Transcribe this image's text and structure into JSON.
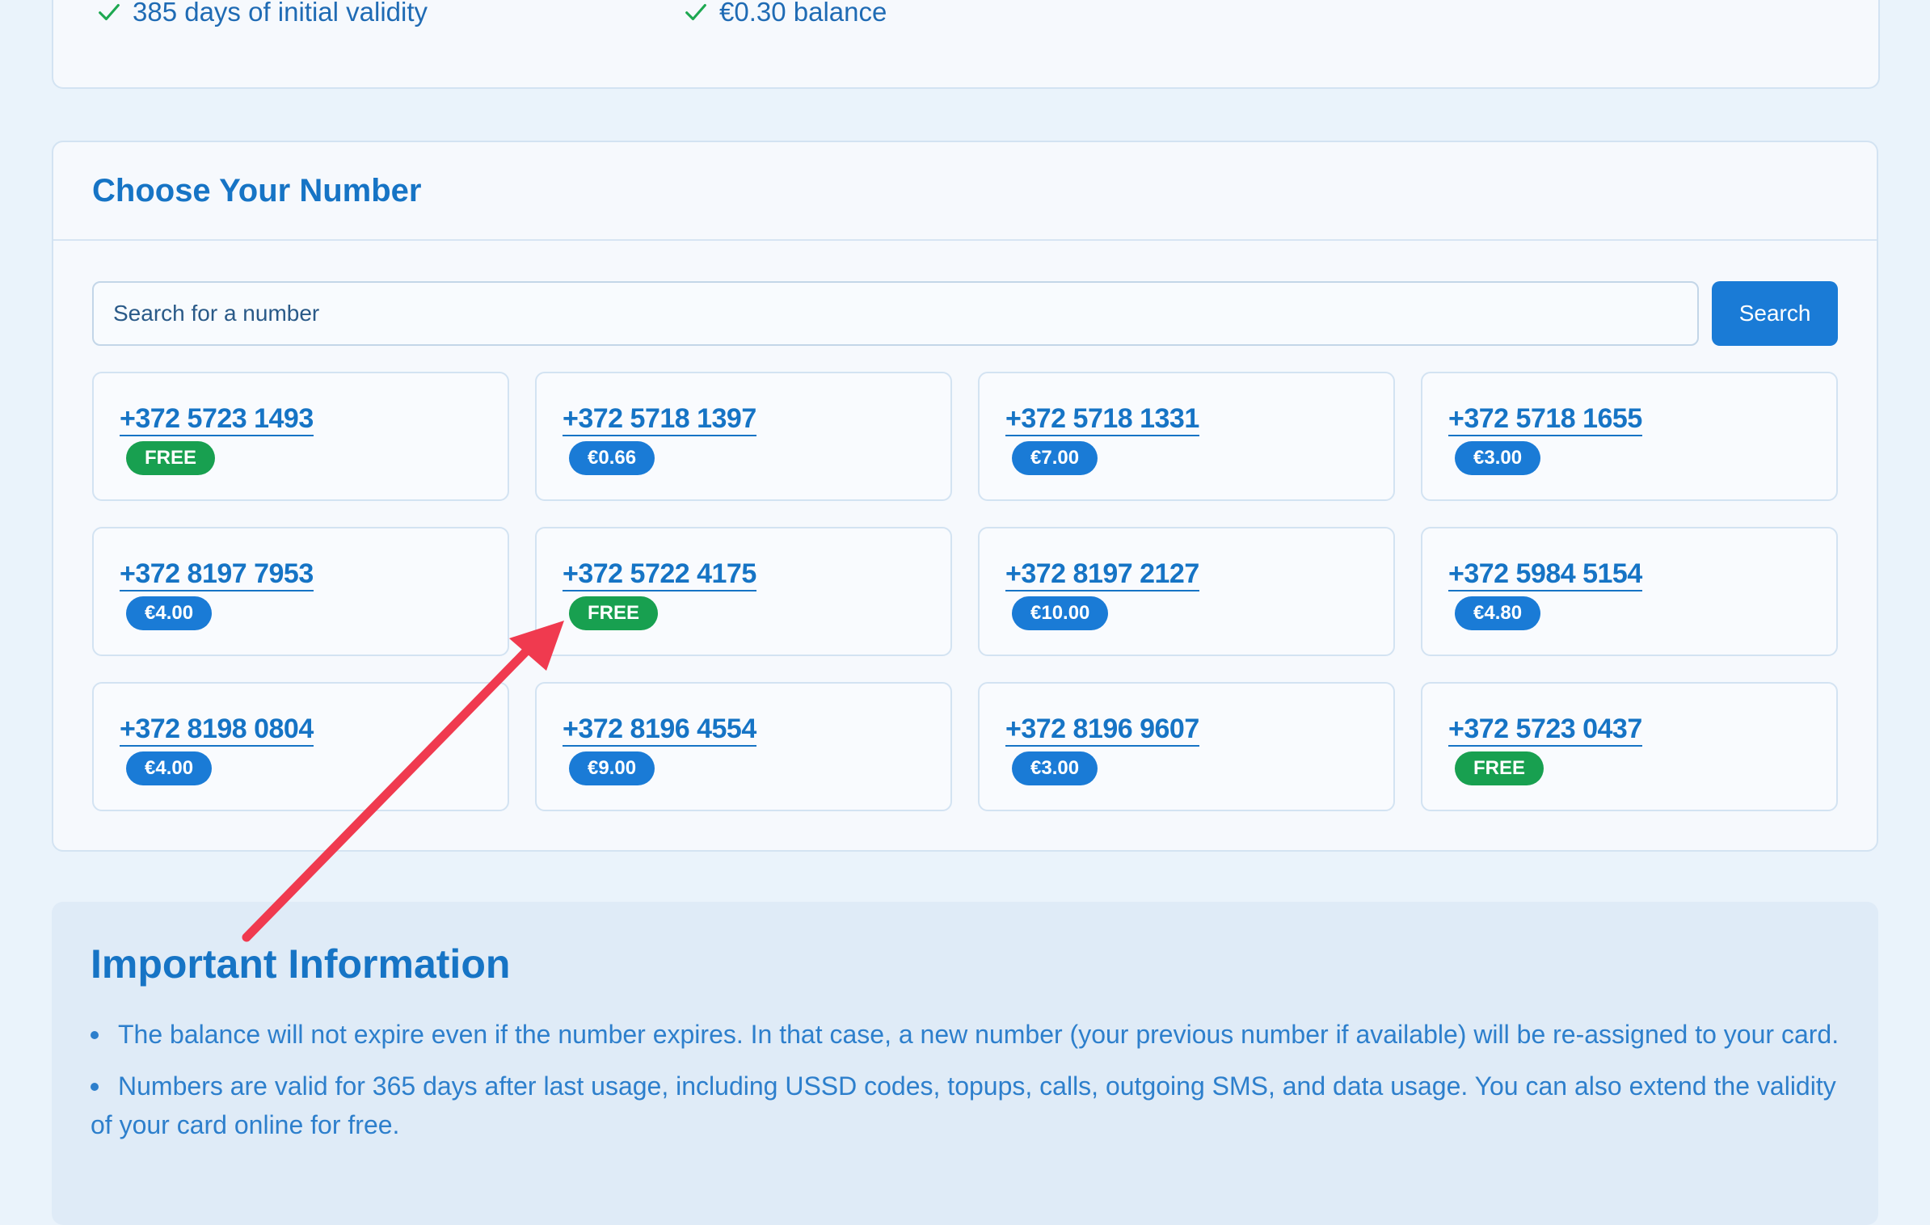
{
  "features": [
    {
      "icon": "check-icon",
      "text": "385 days of initial validity"
    },
    {
      "icon": "check-icon",
      "text": "€0.30 balance"
    }
  ],
  "choose": {
    "title": "Choose Your Number",
    "search": {
      "placeholder": "Search for a number",
      "value": "",
      "button_label": "Search"
    },
    "numbers": [
      {
        "number": "+372 5723 1493",
        "price": "FREE",
        "free": true
      },
      {
        "number": "+372 5718 1397",
        "price": "€0.66",
        "free": false
      },
      {
        "number": "+372 5718 1331",
        "price": "€7.00",
        "free": false
      },
      {
        "number": "+372 5718 1655",
        "price": "€3.00",
        "free": false
      },
      {
        "number": "+372 8197 7953",
        "price": "€4.00",
        "free": false
      },
      {
        "number": "+372 5722 4175",
        "price": "FREE",
        "free": true
      },
      {
        "number": "+372 8197 2127",
        "price": "€10.00",
        "free": false
      },
      {
        "number": "+372 5984 5154",
        "price": "€4.80",
        "free": false
      },
      {
        "number": "+372 8198 0804",
        "price": "€4.00",
        "free": false
      },
      {
        "number": "+372 8196 4554",
        "price": "€9.00",
        "free": false
      },
      {
        "number": "+372 8196 9607",
        "price": "€3.00",
        "free": false
      },
      {
        "number": "+372 5723 0437",
        "price": "FREE",
        "free": true
      }
    ]
  },
  "info": {
    "title": "Important Information",
    "items": [
      "The balance will not expire even if the number expires. In that case, a new number (your previous number if available) will be re-assigned to your card.",
      "Numbers are valid for 365 days after last usage, including USSD codes, topups, calls, outgoing SMS, and data usage. You can also extend the validity of your card online for free."
    ]
  },
  "colors": {
    "accent": "#1674c5",
    "button": "#1a7bd6",
    "free_badge": "#18a050",
    "check": "#1da851",
    "arrow": "#f03a4f",
    "page_bg": "#eaf3fb"
  }
}
